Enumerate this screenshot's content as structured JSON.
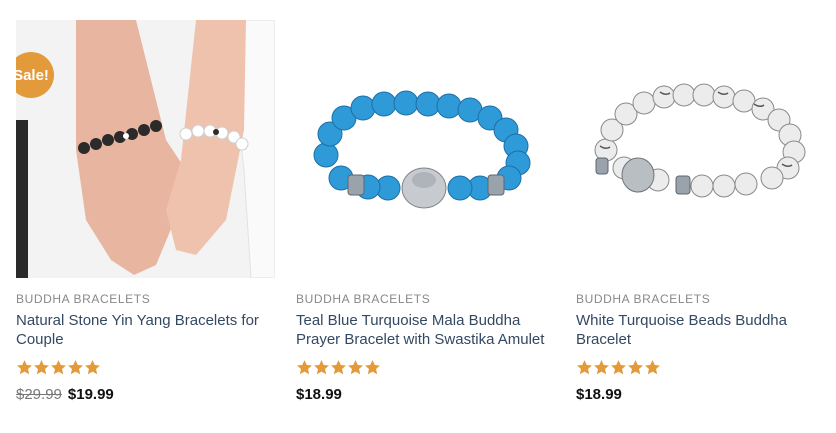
{
  "products": [
    {
      "badge": "Sale!",
      "category": "BUDDHA BRACELETS",
      "title": "Natural Stone Yin Yang Bracelets for Couple",
      "rating": 5,
      "old_price": "$29.99",
      "price": "$19.99"
    },
    {
      "category": "BUDDHA BRACELETS",
      "title": "Teal Blue Turquoise Mala Buddha Prayer Bracelet with Swastika Amulet",
      "rating": 5,
      "price": "$18.99"
    },
    {
      "category": "BUDDHA BRACELETS",
      "title": "White Turquoise Beads Buddha Bracelet",
      "rating": 5,
      "price": "$18.99"
    }
  ],
  "colors": {
    "accent": "#e29a3b",
    "title": "#334862",
    "category": "#888888"
  }
}
